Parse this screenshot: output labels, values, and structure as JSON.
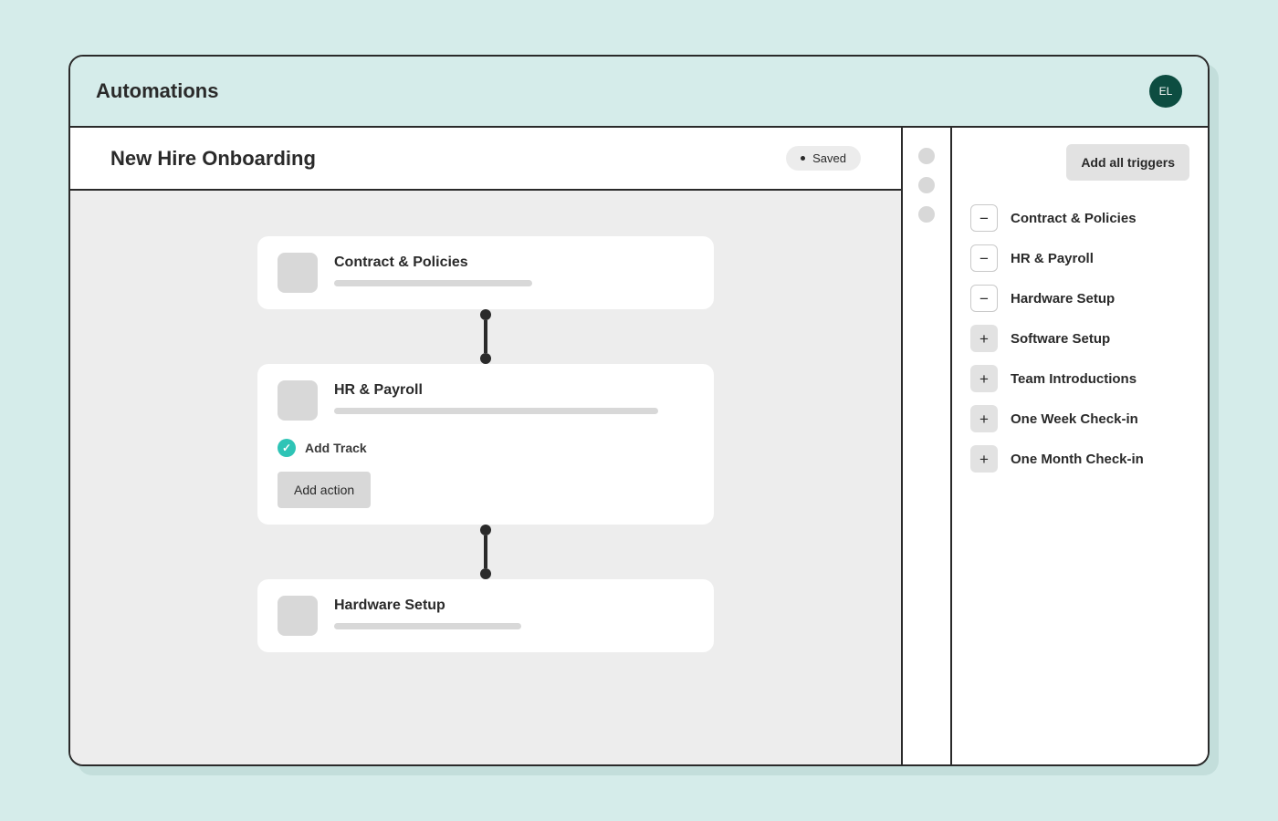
{
  "header": {
    "title": "Automations",
    "avatar_initials": "EL"
  },
  "subheader": {
    "title": "New Hire Onboarding",
    "status": "Saved"
  },
  "canvas": {
    "nodes": [
      {
        "title": "Contract & Policies"
      },
      {
        "title": "HR & Payroll",
        "add_track_label": "Add Track",
        "add_action_label": "Add action"
      },
      {
        "title": "Hardware Setup"
      }
    ]
  },
  "side": {
    "add_all_label": "Add all triggers",
    "triggers": [
      {
        "label": "Contract & Policies",
        "state": "added"
      },
      {
        "label": "HR & Payroll",
        "state": "added"
      },
      {
        "label": "Hardware Setup",
        "state": "added"
      },
      {
        "label": "Software Setup",
        "state": "available"
      },
      {
        "label": "Team Introductions",
        "state": "available"
      },
      {
        "label": "One Week Check-in",
        "state": "available"
      },
      {
        "label": "One Month Check-in",
        "state": "available"
      }
    ]
  }
}
